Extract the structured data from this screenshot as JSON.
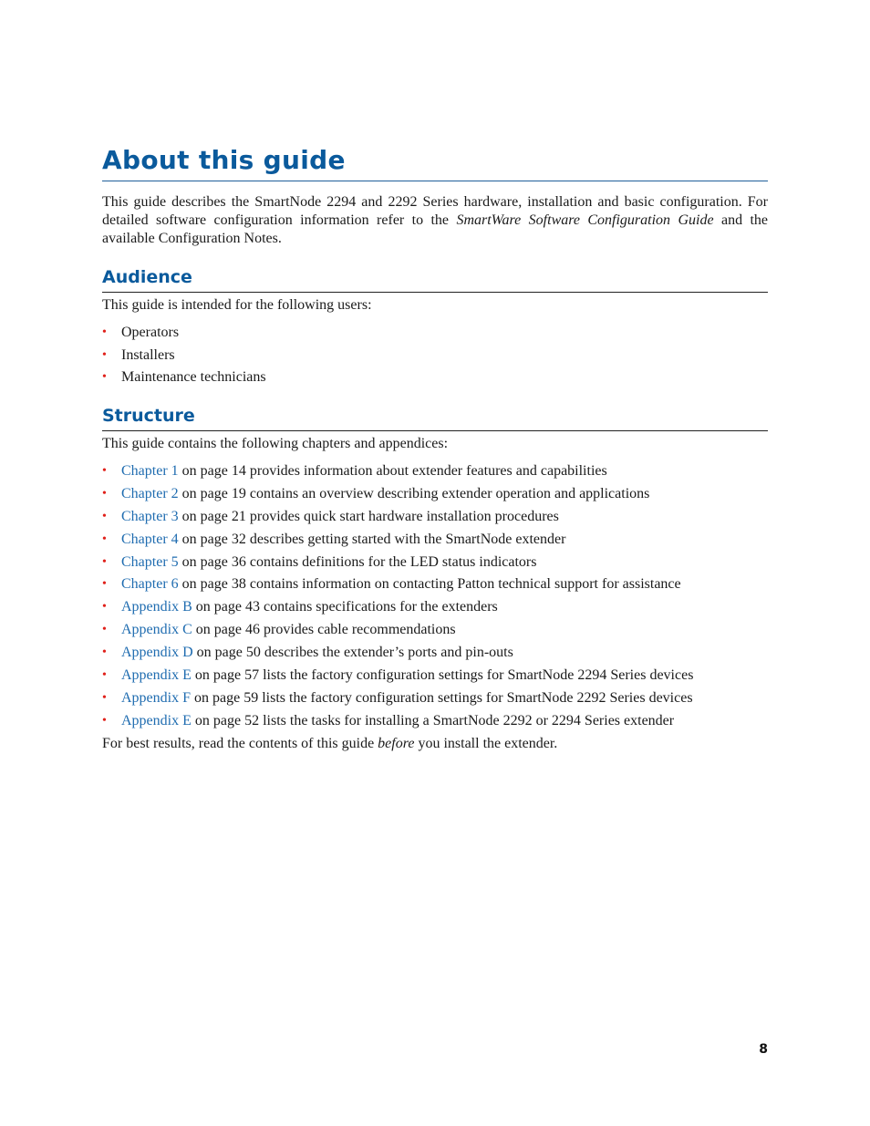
{
  "title": "About this guide",
  "intro": {
    "before": "This guide describes the SmartNode 2294 and 2292 Series hardware, installation and basic configuration. For detailed software configuration information refer to the ",
    "italic": "SmartWare Software Configuration Guide",
    "after": " and the available Configuration Notes."
  },
  "audience": {
    "heading": "Audience",
    "lead": "This guide is intended for the following users:",
    "items": [
      "Operators",
      "Installers",
      "Maintenance technicians"
    ]
  },
  "structure": {
    "heading": "Structure",
    "lead": "This guide contains the following chapters and appendices:",
    "items": [
      {
        "link": "Chapter 1",
        "text": " on page 14 provides information about extender features and capabilities"
      },
      {
        "link": "Chapter 2",
        "text": " on page 19 contains an overview describing extender operation and applications"
      },
      {
        "link": "Chapter 3",
        "text": " on page 21 provides quick start hardware installation procedures"
      },
      {
        "link": "Chapter 4",
        "text": " on page 32 describes getting started with the SmartNode extender"
      },
      {
        "link": "Chapter 5",
        "text": " on page 36 contains definitions for the LED status indicators"
      },
      {
        "link": "Chapter 6",
        "text": " on page 38 contains information on contacting Patton technical support for assistance"
      },
      {
        "link": "Appendix B",
        "text": " on page 43 contains specifications for the extenders"
      },
      {
        "link": "Appendix C",
        "text": " on page 46 provides cable recommendations"
      },
      {
        "link": "Appendix D",
        "text": " on page 50 describes the extender’s ports and pin-outs"
      },
      {
        "link": "Appendix E",
        "text": " on page 57 lists the factory configuration settings for SmartNode 2294 Series devices"
      },
      {
        "link": "Appendix F",
        "text": " on page 59 lists the factory configuration settings for SmartNode 2292 Series devices"
      },
      {
        "link": "Appendix E",
        "text": " on page 52 lists the tasks for installing a SmartNode 2292 or 2294 Series extender"
      }
    ],
    "closing": {
      "before": "For best results, read the contents of this guide ",
      "italic": "before",
      "after": " you install the extender."
    }
  },
  "page_number": "8",
  "colors": {
    "heading": "#0a5a9c",
    "link": "#1f6cb0",
    "bullet": "#e0201a"
  }
}
